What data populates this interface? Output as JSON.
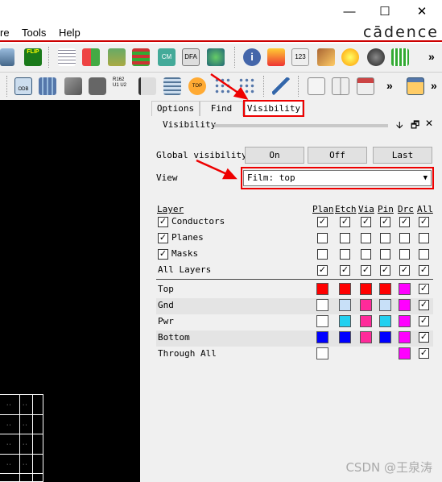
{
  "window": {
    "minimize_glyph": "—",
    "maximize_glyph": "☐",
    "close_glyph": "✕"
  },
  "menubar": {
    "items": [
      "re",
      "Tools",
      "Help"
    ],
    "brand": "cādence"
  },
  "toolbar1": {
    "icons": [
      "3d-view-icon",
      "flip-icon",
      "grid-icon",
      "color-palette-icon",
      "stack-icon",
      "layers-stack-icon",
      "cm-icon",
      "dfa-icon",
      "globe-icon",
      "info-icon",
      "report-icon",
      "numbering-icon",
      "broom-icon",
      "sun-icon",
      "bomb-icon",
      "bars-icon",
      "more-icon"
    ],
    "labels": {
      "flip": "FLIP",
      "numbering": "123",
      "cm": "CM",
      "dfa": "DFA"
    }
  },
  "toolbar2": {
    "icons": [
      "odb-icon",
      "book-icon",
      "wrench-icon",
      "camera-icon",
      "refdes-icon",
      "flag-icon",
      "grid-select-icon",
      "top-pin-icon",
      "dot-grid-icon",
      "net-icon",
      "clipboard-icon",
      "open-book-icon",
      "calendar-icon",
      "more-icon",
      "window-icon",
      "more-icon"
    ],
    "labels": {
      "odb": "ODB",
      "refdes": "R162 U1 U2",
      "top": "TOP"
    }
  },
  "panel": {
    "tabs": [
      "Options",
      "Find",
      "Visibility"
    ],
    "active_tab": "Visibility",
    "title": "Visibility",
    "controls": {
      "pin": "🡫",
      "restore": "🗗",
      "close": "✕"
    },
    "global_visibility_label": "Global visibility",
    "global_buttons": [
      "On",
      "Off",
      "Last"
    ],
    "view_label": "View",
    "view_value": "Film: top",
    "columns": [
      "Plan",
      "Etch",
      "Via",
      "Pin",
      "Drc",
      "All"
    ],
    "layer_header": "Layer",
    "layer_rows": [
      {
        "label": "Conductors",
        "checked": true,
        "values": [
          true,
          true,
          true,
          true,
          true,
          true
        ]
      },
      {
        "label": "Planes",
        "checked": true,
        "values": [
          false,
          false,
          false,
          false,
          false,
          false
        ]
      },
      {
        "label": "Masks",
        "checked": true,
        "values": [
          false,
          false,
          false,
          false,
          false,
          false
        ]
      },
      {
        "label": "All Layers",
        "checked": null,
        "values": [
          true,
          true,
          true,
          true,
          true,
          true
        ]
      }
    ],
    "film_rows": [
      {
        "label": "Top",
        "swatches": [
          "#ff0000",
          "#ff0000",
          "#ff0000",
          "#ff0000",
          "#ff00ff"
        ],
        "all": true,
        "shaded": false
      },
      {
        "label": "Gnd",
        "swatches": [
          "#ffffff",
          "#c8e0f8",
          "#ff2a9a",
          "#c8e0f8",
          "#ff00ff"
        ],
        "all": true,
        "shaded": true
      },
      {
        "label": "Pwr",
        "swatches": [
          "#ffffff",
          "#22d0f0",
          "#ff2a9a",
          "#22d0f0",
          "#ff00ff"
        ],
        "all": true,
        "shaded": false
      },
      {
        "label": "Bottom",
        "swatches": [
          "#0000ff",
          "#0000ff",
          "#ff2a9a",
          "#0000ff",
          "#ff00ff"
        ],
        "all": true,
        "shaded": true
      },
      {
        "label": "Through All",
        "swatches": [
          "#ffffff",
          null,
          null,
          null,
          "#ff00ff"
        ],
        "all": true,
        "shaded": false
      }
    ]
  },
  "watermark": "CSDN @王泉涛",
  "colors": {
    "highlight": "#e00000",
    "menu_underline": "#cc0000"
  }
}
